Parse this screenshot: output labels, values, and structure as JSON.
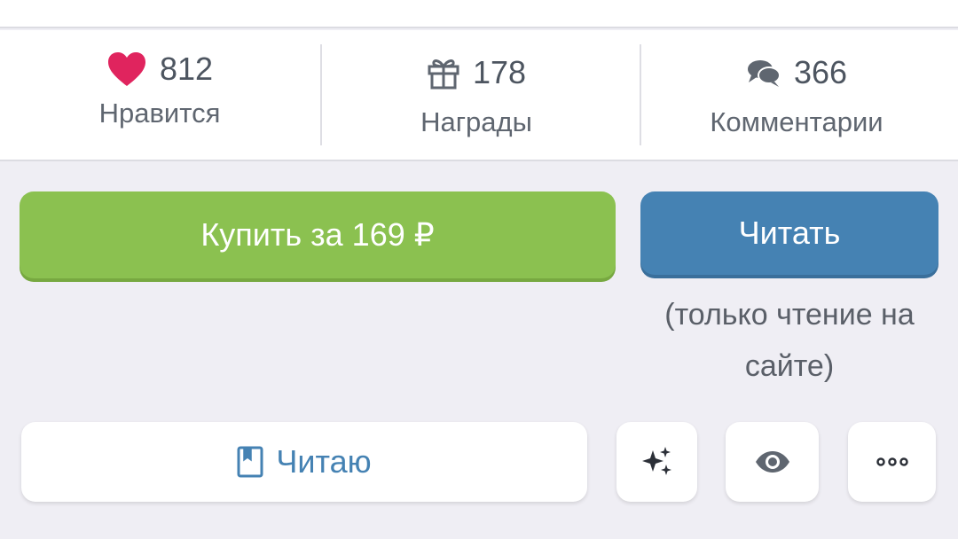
{
  "stats": {
    "likes": {
      "count": "812",
      "label": "Нравится",
      "icon": "heart-icon",
      "color": "#e0245e"
    },
    "awards": {
      "count": "178",
      "label": "Награды",
      "icon": "gift-icon"
    },
    "comments": {
      "count": "366",
      "label": "Комментарии",
      "icon": "comments-icon"
    }
  },
  "actions": {
    "buy_label": "Купить за 169 ₽",
    "read_label": "Читать",
    "read_note": "(только чтение на сайте)",
    "reading_label": "Читаю"
  },
  "icons": {
    "reading": "bookmark-book-icon",
    "sparkle": "sparkles-icon",
    "eye": "eye-icon",
    "more": "more-dots-icon"
  },
  "colors": {
    "buy": "#8bc150",
    "read": "#4582b3",
    "reading_text": "#4582b3"
  }
}
